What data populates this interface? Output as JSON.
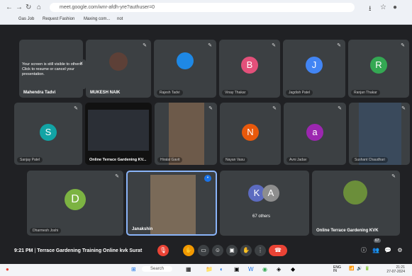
{
  "browser": {
    "url": "meet.google.com/wnr-afdh-yre?authuser=0"
  },
  "bookmarks": [
    "Gas Job",
    "Request Fashion",
    "Maxing com...",
    "not"
  ],
  "popup": {
    "text": "Your screen is still visible to others. Click to resume or cancel your presentation.",
    "close": "×"
  },
  "tiles": [
    {
      "id": "mahendra",
      "name": "Mahendra Tadvi"
    },
    {
      "id": "mukesh",
      "name": "MUKESH NAIK"
    },
    {
      "id": "t3",
      "name": "Rajesh Tadvi"
    },
    {
      "id": "t4",
      "name": "Vinay Thakar",
      "initial": "B",
      "color": "#e3507a"
    },
    {
      "id": "t5",
      "name": "Jagdish Patel",
      "initial": "J",
      "color": "#4285f4"
    },
    {
      "id": "t6",
      "name": "Ranjan Thakar",
      "initial": "R",
      "color": "#34a853"
    },
    {
      "id": "t7",
      "name": "Sanjay Patel",
      "initial": "S",
      "color": "#12a4a5"
    },
    {
      "id": "t8",
      "name": "Online Terrace Gardening KV..."
    },
    {
      "id": "t9",
      "name": "Hiralal Gavit"
    },
    {
      "id": "t10",
      "name": "Nayan Vasu",
      "initial": "N",
      "color": "#e8590c"
    },
    {
      "id": "t11",
      "name": "Avni Jadav",
      "initial": "a",
      "color": "#9c27b0"
    },
    {
      "id": "t12",
      "name": "Sushant Chaudhari"
    },
    {
      "id": "t13",
      "name": "Dharmesh Joshi",
      "initial": "D",
      "color": "#7cb342"
    },
    {
      "id": "t14",
      "name": "Janakshin"
    },
    {
      "id": "t15",
      "name": "67 others",
      "initial": "K",
      "initial2": "A"
    },
    {
      "id": "t16",
      "name": "Online Terrace Gardening KVK"
    }
  ],
  "meeting": {
    "time": "9:21 PM",
    "separator": "|",
    "title": "Terrace Gardening Training Online kvk Surat"
  },
  "participant_count": "67",
  "taskbar": {
    "search": "Search",
    "lang": "ENG\nIN",
    "time": "21:21",
    "date": "27-07-2024"
  }
}
